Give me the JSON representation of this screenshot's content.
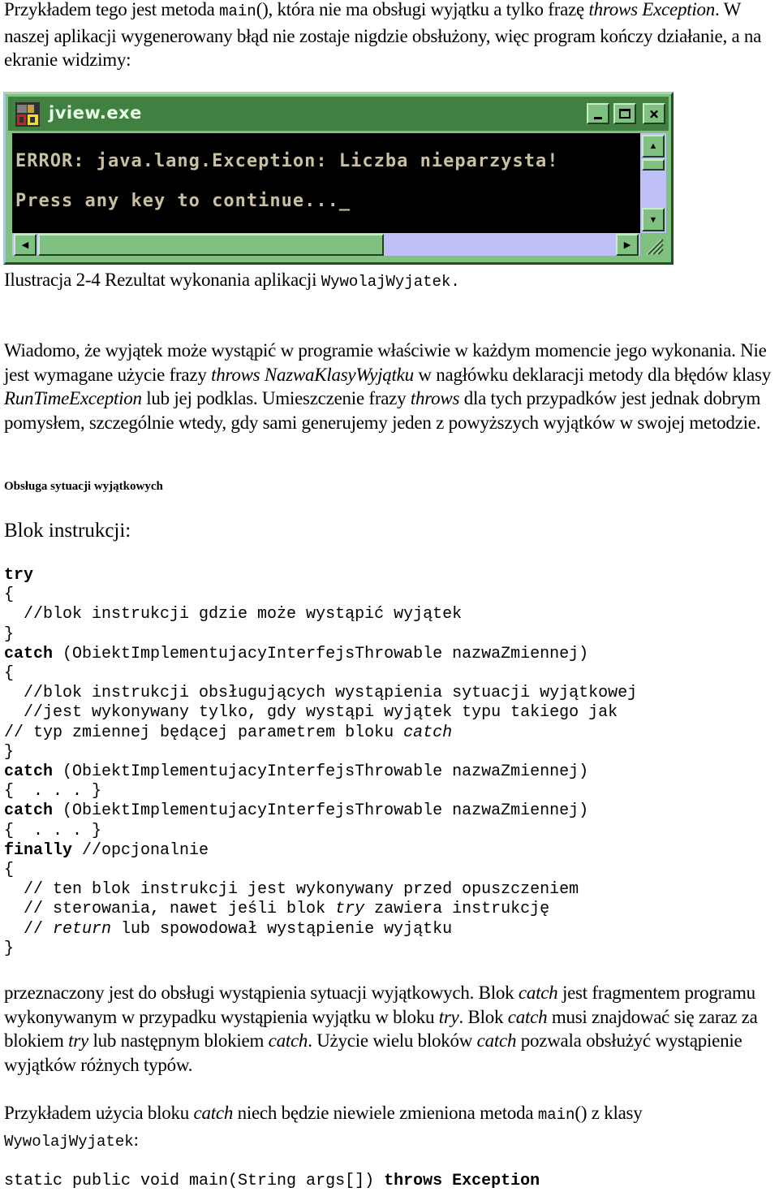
{
  "intro": {
    "p1_a": "Przykładem tego jest metoda ",
    "p1_code": "main",
    "p1_b": "(), która nie ma obsługi wyjątku a tylko frazę ",
    "p1_it": "throws Exception",
    "p1_c": ". W naszej aplikacji wygenerowany błąd nie zostaje nigdzie obsłużony, więc program kończy działanie, a na ekranie widzimy:"
  },
  "window": {
    "title": "jview.exe",
    "icon": "msdev-app-icon",
    "buttons": {
      "minimize": "minimize-icon",
      "maximize": "maximize-icon",
      "close": "×"
    },
    "console_lines": [
      "ERROR: java.lang.Exception: Liczba nieparzysta!",
      "Press any key to continue..._"
    ],
    "colors": {
      "frame": "#80c080",
      "titlebar": "#408040",
      "console_bg": "#000000",
      "console_text": "#c8c0a0",
      "scroll_track": "#c0c0f8"
    },
    "hscroll_position": 0.0,
    "hscroll_visible_fraction": 0.58,
    "vscroll_position": 0.0,
    "vscroll_visible_fraction": 0.2
  },
  "caption": {
    "text": "Ilustracja 2-4 Rezultat wykonania aplikacji ",
    "code": "WywolajWyjatek."
  },
  "para2": {
    "a": "Wiadomo, że wyjątek może wystąpić w programie właściwie w każdym momencie jego wykonania. Nie jest wymagane użycie frazy ",
    "it1": "throws NazwaKlasyWyjątku",
    "b": " w nagłówku deklaracji metody dla błędów klasy ",
    "it2": "RunTimeException",
    "c": " lub jej podklas. Umieszczenie frazy ",
    "it3": "throws",
    "d": " dla tych przypadków jest jednak dobrym pomysłem, szczególnie wtedy, gdy sami generujemy jeden z powyższych wyjątków w swojej metodzie."
  },
  "subheading": "Obsługa sytuacji wyjątkowych",
  "block_label": "Blok instrukcji:",
  "code": {
    "kw_try": "try",
    "open": "{",
    "close": "}",
    "try_comment": "  //blok instrukcji gdzie może wystąpić wyjątek",
    "kw_catch": "catch",
    "catch_args": " (ObiektImplementujacyInterfejsThrowable nazwaZmiennej)",
    "catch_c1": "  //blok instrukcji obsługujących wystąpienia sytuacji wyjątkowej",
    "catch_c2": "  //jest wykonywany tylko, gdy wystąpi wyjątek typu takiego jak",
    "catch_c3a": "// typ zmiennej będącej parametrem bloku ",
    "catch_c3it": "catch",
    "ellipsis_block": "{  . . . }",
    "kw_finally": "finally",
    "finally_comment": " //opcjonalnie",
    "fin_c1": "  // ten blok instrukcji jest wykonywany przed opuszczeniem",
    "fin_c2a": "  // sterowania, nawet jeśli blok ",
    "fin_c2it": "try",
    "fin_c2b": " zawiera instrukcję",
    "fin_c3a": "  // ",
    "fin_c3it": "return",
    "fin_c3b": " lub spowodował wystąpienie wyjątku"
  },
  "para3": {
    "a": "przeznaczony jest do obsługi wystąpienia sytuacji wyjątkowych. Blok ",
    "it1": "catch",
    "b": " jest fragmentem programu wykonywanym w przypadku wystąpienia wyjątku w bloku ",
    "it2": "try",
    "c": ". Blok ",
    "it3": "catch",
    "d": " musi znajdować się zaraz za blokiem ",
    "it4": "try",
    "e": " lub następnym blokiem ",
    "it5": "catch",
    "f": ". Użycie wielu bloków ",
    "it6": "catch",
    "g": " pozwala obsłużyć wystąpienie wyjątków różnych typów."
  },
  "para4": {
    "a": "Przykładem użycia bloku ",
    "it1": "catch",
    "b": " niech będzie niewiele zmieniona metoda ",
    "code1": "main",
    "c": "() z klasy ",
    "code2": "WywolajWyjatek",
    "d": ":"
  },
  "signature": {
    "plain": "static public void main(String args[]) ",
    "kw": "throws Exception"
  }
}
